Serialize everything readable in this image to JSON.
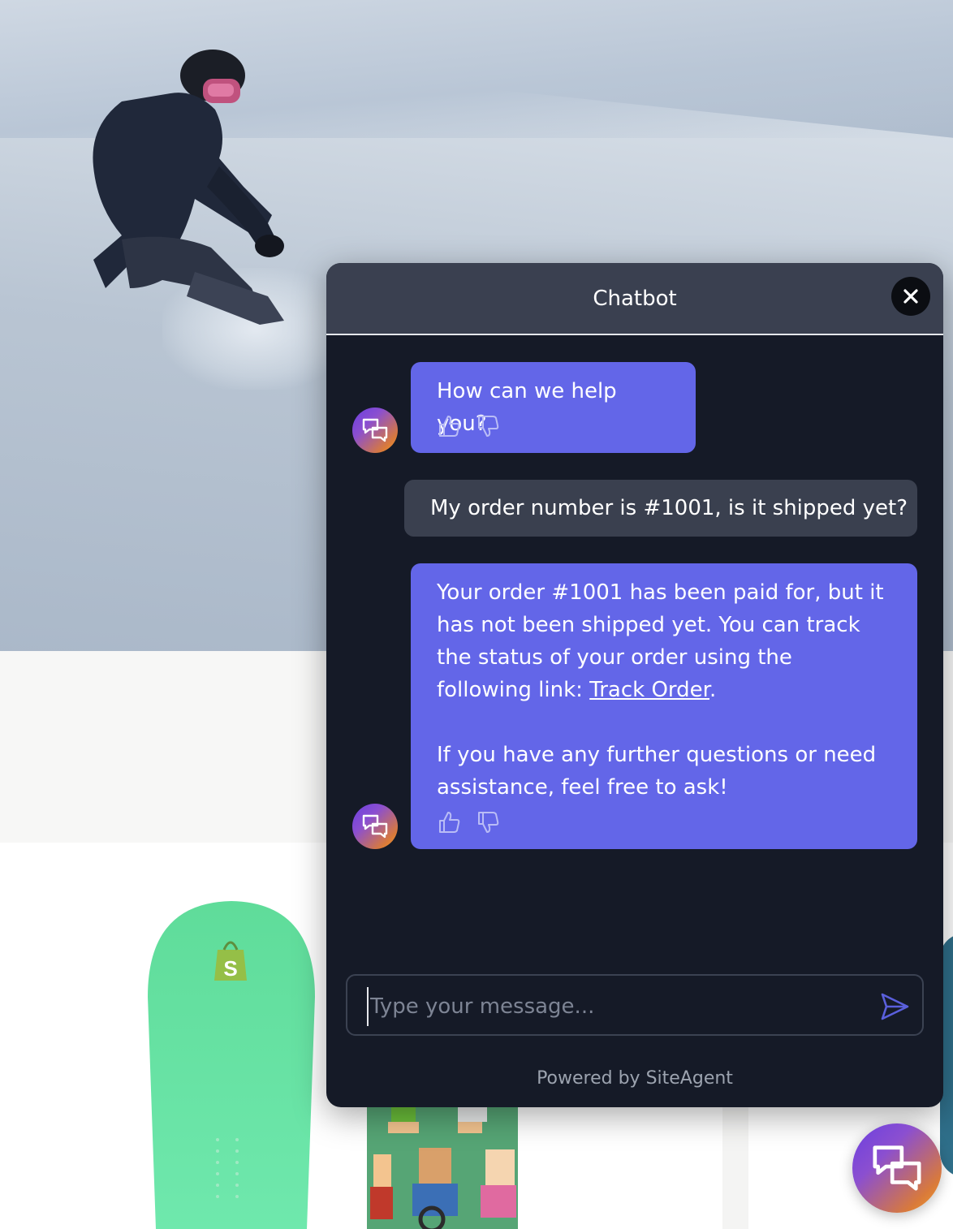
{
  "chat": {
    "title": "Chatbot",
    "messages": [
      {
        "from": "bot",
        "text": "How can we help you?"
      },
      {
        "from": "user",
        "text": "My order number is #1001, is it shipped yet?"
      },
      {
        "from": "bot",
        "text_before_link": "Your order #1001 has been paid for, but it has not been shipped yet. You can track the status of your order using the following link: ",
        "link_text": "Track Order",
        "text_after_link": ".",
        "text_followup": "If you have any further questions or need assistance, feel free to ask!"
      }
    ],
    "input": {
      "placeholder": "Type your message...",
      "value": ""
    },
    "footer": "Powered by SiteAgent"
  },
  "colors": {
    "panel_bg": "#151a27",
    "header_bg": "#3a4050",
    "bot_bubble": "#6366e8",
    "user_bubble": "#3a404f",
    "avatar_gradient": [
      "#6b3fe0",
      "#f0a030"
    ]
  },
  "icons": [
    "close-icon",
    "chat-bubbles-icon",
    "thumbs-up-icon",
    "thumbs-down-icon",
    "send-icon"
  ]
}
